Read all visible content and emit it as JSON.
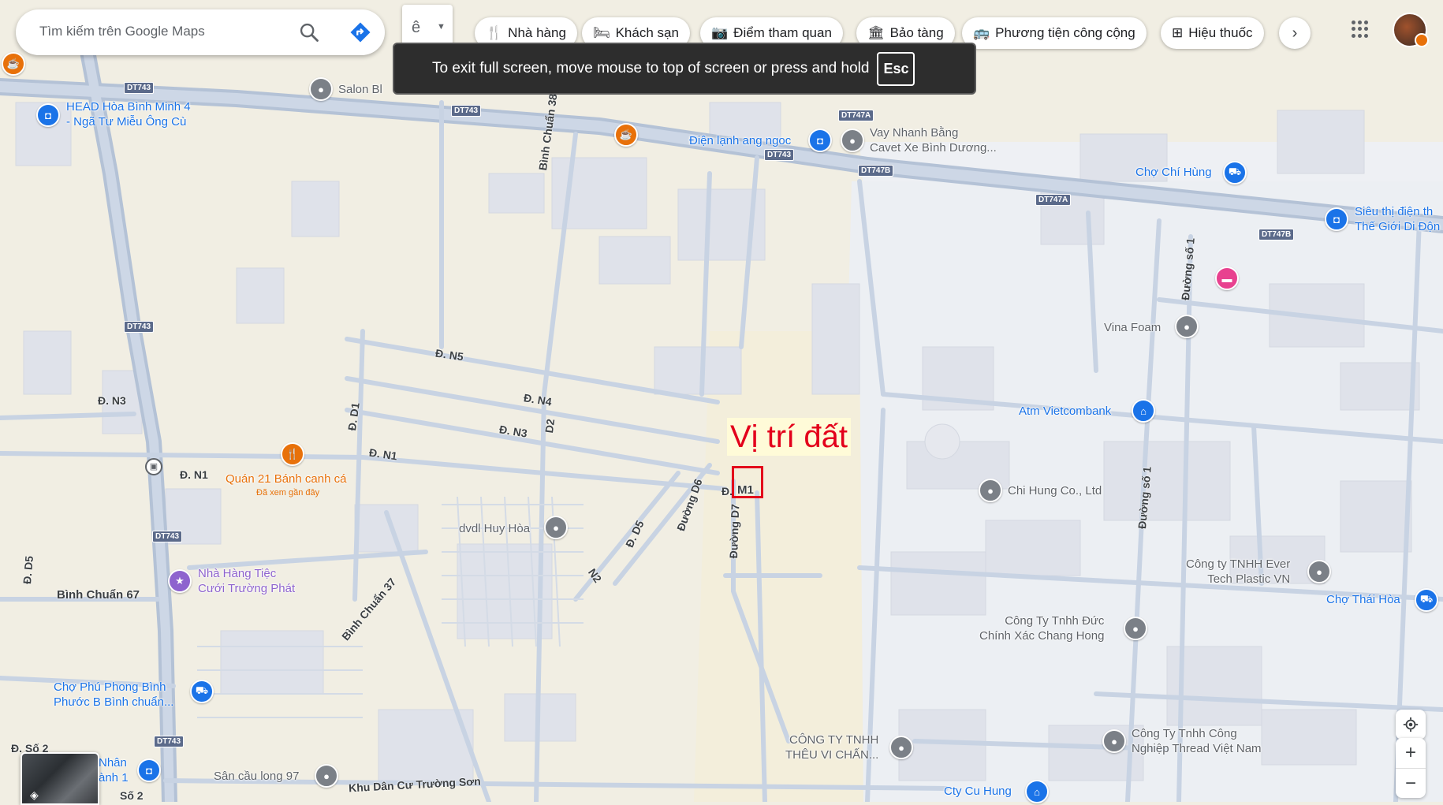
{
  "search": {
    "placeholder": "Tìm kiếm trên Google Maps"
  },
  "chips": [
    "Nhà hàng",
    "Khách sạn",
    "Điểm tham quan",
    "Bảo tàng",
    "Phương tiện công cộng",
    "Hiệu thuốc"
  ],
  "layer_label": "ê",
  "toast": {
    "message": "To exit full screen, move mouse to top of screen or press and hold",
    "key": "Esc"
  },
  "annotation": {
    "label": "Vị trí đất",
    "marker_road": "M1",
    "color": "#ff0000"
  },
  "road_shields": [
    "DT743",
    "DT743",
    "DT747A",
    "DT743",
    "DT747B",
    "DT747A",
    "DT747B",
    "DT743",
    "DT743",
    "DT743"
  ],
  "road_names": [
    "Bình Chuẩn 38",
    "Đ. N5",
    "Đ. N4",
    "Đ. N3",
    "Đ. N3",
    "Đ. D1",
    "D2",
    "Đ. N1",
    "Đ. N1",
    "Đ.",
    "Đường D6",
    "Đường D7",
    "Đ. D5",
    "N2",
    "Bình Chuẩn 37",
    "Bình Chuẩn 67",
    "Đ. D5",
    "Đường số 1",
    "Đường số 1",
    "Khu Dân Cư Trường Sơn",
    "Đ. Số 2",
    "Số 2"
  ],
  "pois": [
    {
      "name": "Salon Bl",
      "color": "#5f6368",
      "icon": "circle-pin-icon"
    },
    {
      "name": "HEAD Hòa Bình Minh 4\n- Ngã Tư Miễu Ông Cù",
      "color": "#1a73e8",
      "icon": "shopping-bag-icon"
    },
    {
      "name": "Điện lạnh ang ngoc",
      "color": "#1a73e8",
      "icon": "shopping-bag-icon"
    },
    {
      "name": "Vay Nhanh Bằng\nCavet Xe Bình Dương...",
      "color": "#5f6368",
      "icon": "circle-pin-icon"
    },
    {
      "name": "Chợ Chí Hùng",
      "color": "#1a73e8",
      "icon": "cart-icon"
    },
    {
      "name": "Siêu thị điện th\nThế Giới Di Độn",
      "color": "#1a73e8",
      "icon": "shopping-bag-icon"
    },
    {
      "name": "Vina Foam",
      "color": "#5f6368",
      "icon": "circle-pin-icon"
    },
    {
      "name": "Atm Vietcombank",
      "color": "#1a73e8",
      "icon": "bank-icon"
    },
    {
      "name": "Quán 21 Bánh canh cá",
      "color": "#e8710a",
      "icon": "restaurant-icon",
      "note": "Đã xem gần đây"
    },
    {
      "name": "Chi Hung Co., Ltd",
      "color": "#5f6368",
      "icon": "circle-pin-icon"
    },
    {
      "name": "dvdl Huy Hòa",
      "color": "#5f6368",
      "icon": "circle-pin-icon"
    },
    {
      "name": "Công ty TNHH Ever\nTech Plastic VN",
      "color": "#5f6368",
      "icon": "circle-pin-icon"
    },
    {
      "name": "Nhà Hàng Tiệc\nCưới Trường Phát",
      "color": "#8e63ce",
      "icon": "star-icon"
    },
    {
      "name": "Chợ Thái Hòa",
      "color": "#1a73e8",
      "icon": "cart-icon"
    },
    {
      "name": "Công Ty Tnhh Đức\nChính Xác Chang Hong",
      "color": "#5f6368",
      "icon": "circle-pin-icon"
    },
    {
      "name": "Chợ Phú Phong Bình\nPhước B Bình chuẩn...",
      "color": "#1a73e8",
      "icon": "cart-icon"
    },
    {
      "name": "CÔNG TY TNHH\nTHÊU VI CHẤN...",
      "color": "#5f6368",
      "icon": "circle-pin-icon"
    },
    {
      "name": "Công Ty Tnhh Công\nNghiệp Thread Việt Nam",
      "color": "#5f6368",
      "icon": "circle-pin-icon"
    },
    {
      "name": "Nhân\nành 1",
      "color": "#1a73e8",
      "icon": "shopping-bag-icon"
    },
    {
      "name": "Sân cầu long 97",
      "color": "#5f6368",
      "icon": "circle-pin-icon"
    },
    {
      "name": "Cty Cu Hung",
      "color": "#1a73e8",
      "icon": "bank-icon"
    }
  ],
  "controls": {
    "zoom_in": "+",
    "zoom_out": "−"
  }
}
